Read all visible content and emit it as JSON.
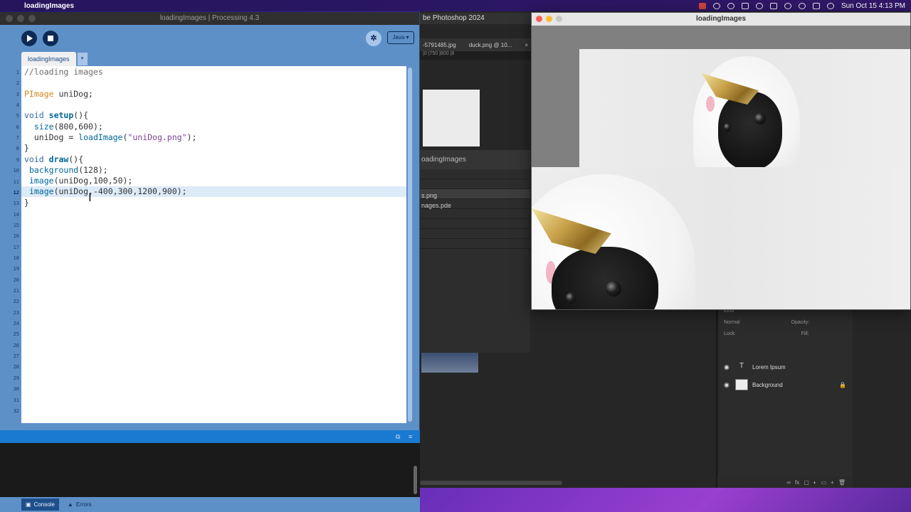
{
  "menubar": {
    "app_name": "loadingImages",
    "datetime": "Sun Oct 15  4:13 PM"
  },
  "photoshop": {
    "title": "be Photoshop 2024",
    "tabs": [
      "-5791485.jpg",
      "duck.png @ 10...",
      "×"
    ],
    "ruler": "|0   |750   |800   |8",
    "panel_title": "oadingImages",
    "files": [
      "s.png",
      "nages.pde"
    ],
    "layers": {
      "kind_label": "Kind",
      "blend_mode": "Normal",
      "opacity_label": "Opacity:",
      "lock_label": "Lock:",
      "fill_label": "Fill:",
      "items": [
        {
          "name": "Lorem Ipsum",
          "type": "T"
        },
        {
          "name": "Background",
          "type": "image"
        }
      ]
    }
  },
  "ide": {
    "window_title": "loadingImages | Processing 4.3",
    "mode": "Java ▾",
    "tab_name": "loadingImages",
    "tab_menu": "▾",
    "current_line": 12,
    "line_numbers": [
      "1",
      "2",
      "3",
      "4",
      "5",
      "6",
      "7",
      "8",
      "9",
      "10",
      "11",
      "12",
      "13",
      "14",
      "15",
      "16",
      "17",
      "18",
      "19",
      "20",
      "21",
      "22",
      "23",
      "24",
      "25",
      "26",
      "27",
      "28",
      "29",
      "30",
      "31",
      "32"
    ],
    "code": {
      "l1": "//loading images",
      "l3a": "PImage",
      "l3b": " uniDog;",
      "l5a": "void",
      "l5b": " ",
      "l5c": "setup",
      "l5d": "(){",
      "l6a": "  ",
      "l6b": "size",
      "l6c": "(800,600);",
      "l7a": "  uniDog = ",
      "l7b": "loadImage",
      "l7c": "(",
      "l7d": "\"uniDog.png\"",
      "l7e": ");",
      "l8": "}",
      "l9a": "void",
      "l9b": " ",
      "l9c": "draw",
      "l9d": "(){",
      "l10a": " ",
      "l10b": "background",
      "l10c": "(128);",
      "l11a": " ",
      "l11b": "image",
      "l11c": "(uniDog,100,50);",
      "l12a": " ",
      "l12b": "image",
      "l12c": "(uniDog,-400,300,1200,900);",
      "l13": "}"
    },
    "console_tab": "Console",
    "errors_tab": "Errors"
  },
  "sketch": {
    "title": "loadingImages"
  }
}
